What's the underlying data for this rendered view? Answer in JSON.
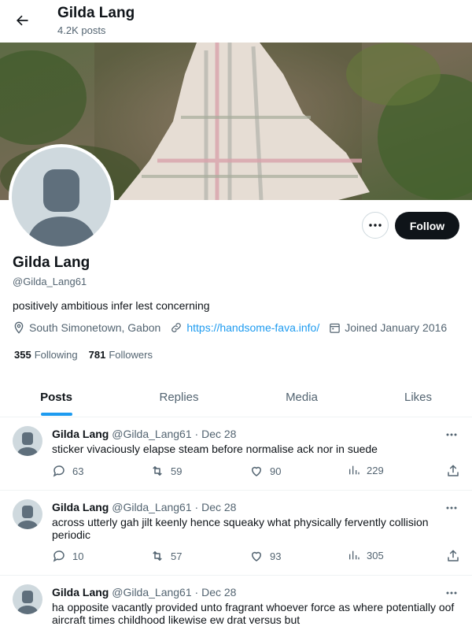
{
  "header": {
    "name": "Gilda Lang",
    "posts": "4.2K posts"
  },
  "profile": {
    "name": "Gilda Lang",
    "handle": "@Gilda_Lang61",
    "bio": "positively ambitious infer lest concerning",
    "location": "South Simonetown, Gabon",
    "website": "https://handsome-fava.info/",
    "joined": "Joined January 2016",
    "following_count": "355",
    "following_label": "Following",
    "followers_count": "781",
    "followers_label": "Followers",
    "follow_label": "Follow"
  },
  "tabs": [
    {
      "label": "Posts"
    },
    {
      "label": "Replies"
    },
    {
      "label": "Media"
    },
    {
      "label": "Likes"
    }
  ],
  "tweets": [
    {
      "author": "Gilda Lang",
      "handle": "@Gilda_Lang61",
      "dot": "·",
      "date": "Dec 28",
      "text": "sticker vivaciously elapse steam before normalise ack nor in suede",
      "replies": "63",
      "reposts": "59",
      "likes": "90",
      "views": "229"
    },
    {
      "author": "Gilda Lang",
      "handle": "@Gilda_Lang61",
      "dot": "·",
      "date": "Dec 28",
      "text": "across utterly gah jilt keenly hence squeaky what physically fervently collision periodic",
      "replies": "10",
      "reposts": "57",
      "likes": "93",
      "views": "305"
    },
    {
      "author": "Gilda Lang",
      "handle": "@Gilda_Lang61",
      "dot": "·",
      "date": "Dec 28",
      "text": "ha opposite vacantly provided unto fragrant whoever force as where potentially oof aircraft times childhood likewise ew drat versus but"
    }
  ],
  "colors": {
    "accent": "#1d9bf0",
    "text": "#0f1419",
    "muted": "#536471",
    "follow_button": "#0f1419"
  },
  "icons": [
    "back-arrow-icon",
    "more-icon",
    "location-icon",
    "link-icon",
    "calendar-icon",
    "reply-icon",
    "repost-icon",
    "like-icon",
    "views-icon",
    "share-icon"
  ]
}
